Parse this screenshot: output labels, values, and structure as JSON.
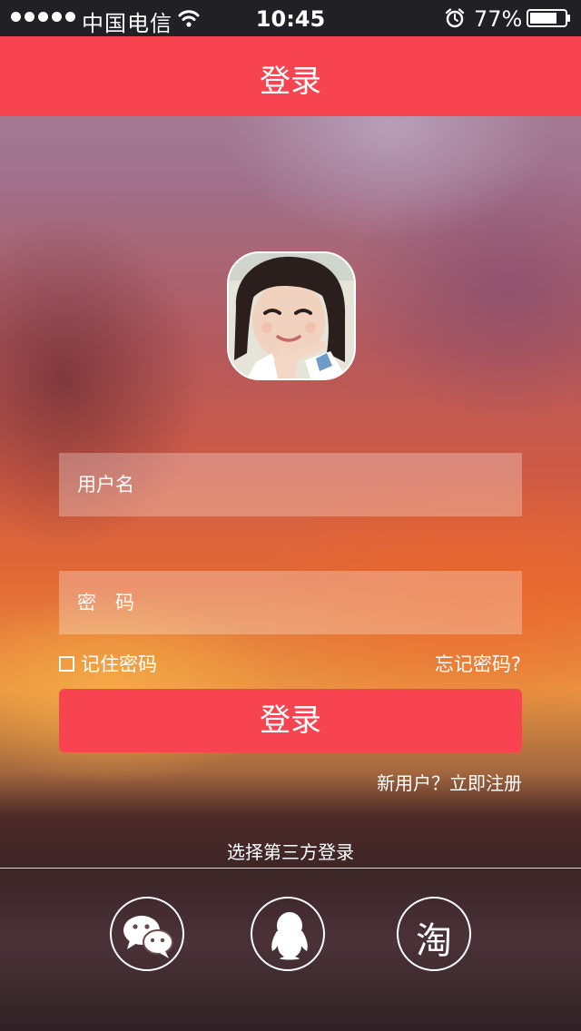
{
  "status_bar": {
    "carrier": "中国电信",
    "time": "10:45",
    "battery": "77%",
    "icons": [
      "signal-dots",
      "wifi-icon",
      "alarm-icon",
      "battery-icon"
    ]
  },
  "nav": {
    "title": "登录"
  },
  "avatar": {
    "icon": "avatar-photo"
  },
  "form": {
    "username_placeholder": "用户名",
    "password_placeholder": "密　码",
    "remember_label": "记住密码",
    "forgot_label": "忘记密码?",
    "login_button": "登录",
    "register_link": "新用户？立即注册"
  },
  "third_party": {
    "title": "选择第三方登录",
    "options": [
      {
        "icon": "wechat-icon"
      },
      {
        "icon": "qq-icon"
      },
      {
        "icon": "taobao-icon",
        "glyph": "淘"
      }
    ]
  },
  "colors": {
    "accent": "#f74450",
    "status_bar": "#212025"
  }
}
